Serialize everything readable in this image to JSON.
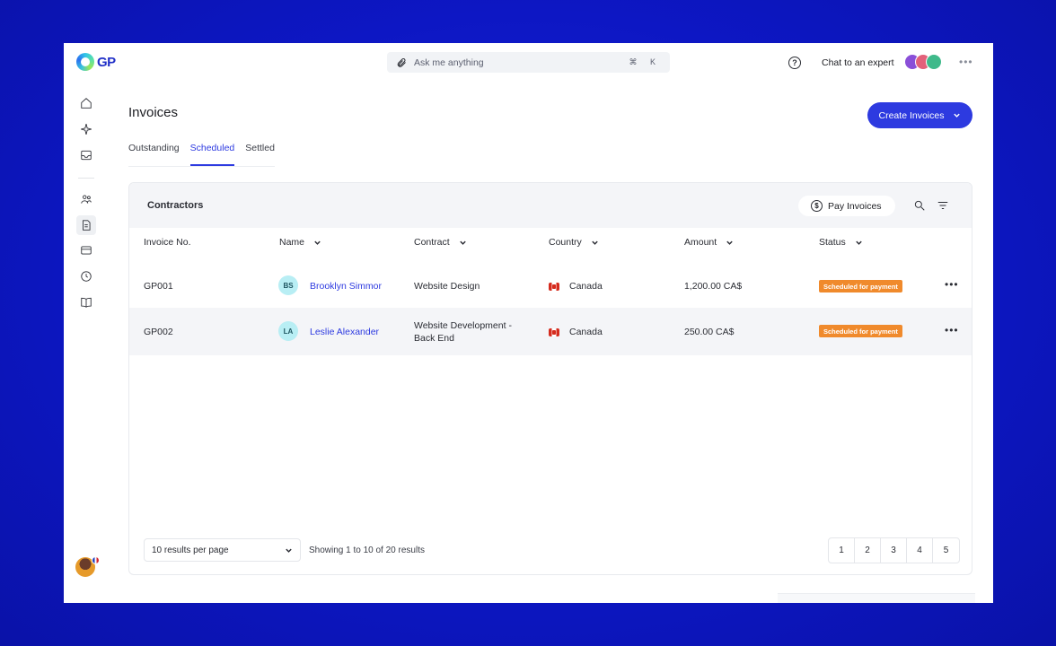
{
  "app": {
    "logo_text": "GP"
  },
  "topbar": {
    "search_placeholder": "Ask me anything",
    "shortcut": "⌘ K",
    "chat_label": "Chat to an expert"
  },
  "page": {
    "title": "Invoices",
    "tabs": [
      {
        "label": "Outstanding",
        "active": false
      },
      {
        "label": "Scheduled",
        "active": true
      },
      {
        "label": "Settled",
        "active": false
      }
    ],
    "create_button": "Create Invoices"
  },
  "table": {
    "section_title": "Contractors",
    "pay_button": "Pay Invoices",
    "columns": [
      "Invoice No.",
      "Name",
      "Contract",
      "Country",
      "Amount",
      "Status"
    ],
    "rows": [
      {
        "invoice": "GP001",
        "initials": "BS",
        "name": "Brooklyn Simmor",
        "contract": "Website Design",
        "country": "Canada",
        "amount": "1,200.00 CA$",
        "status": "Scheduled for payment"
      },
      {
        "invoice": "GP002",
        "initials": "LA",
        "name": "Leslie Alexander",
        "contract": "Website Development - Back End",
        "contract_line1": "Website Development -",
        "contract_line2": "Back End",
        "country": "Canada",
        "amount": "250.00 CA$",
        "status": "Scheduled for payment"
      }
    ]
  },
  "footer": {
    "per_page": "10 results per page",
    "showing": "Showing 1 to 10 of 20 results",
    "pages": [
      "1",
      "2",
      "3",
      "4",
      "5"
    ]
  },
  "colors": {
    "accent": "#2d3ae0",
    "status": "#f08a2c",
    "background": "#0d17c4"
  }
}
